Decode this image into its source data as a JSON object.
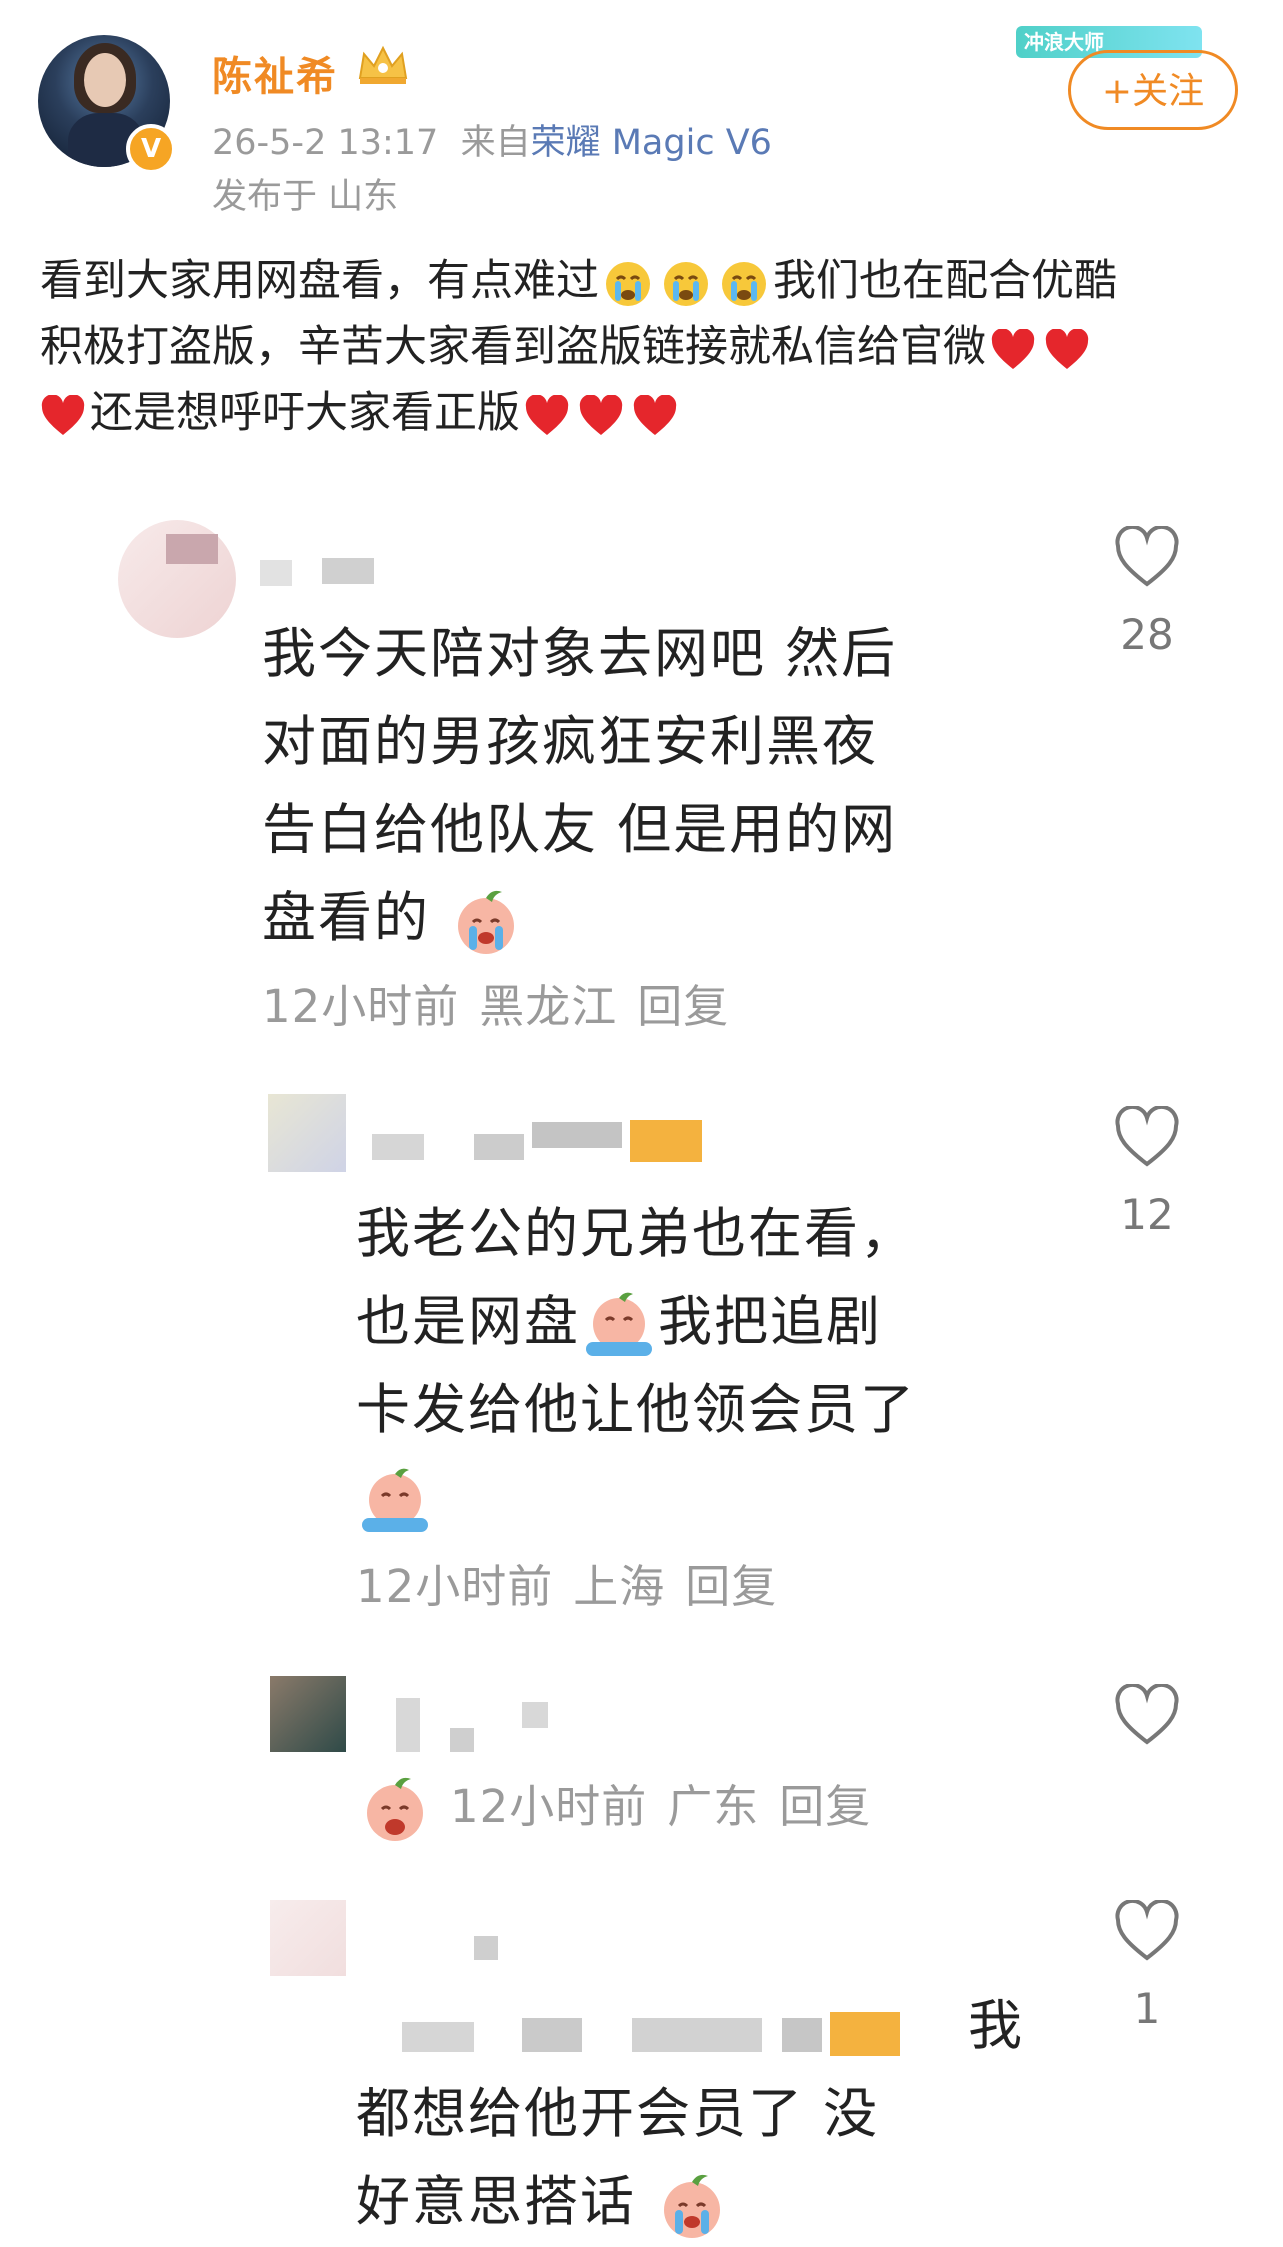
{
  "post": {
    "username": "陈祉希",
    "time": "26-5-2 13:17",
    "source_prefix": "来自",
    "source_device": "荣耀 Magic V6",
    "location": "发布于 山东",
    "follow_label": "+关注",
    "sticker_label": "冲浪大师",
    "text_line1a": "看到大家用网盘看，有点难过",
    "text_line1b": "我们也在配合优酷",
    "text_line2": "积极打盗版，辛苦大家看到盗版链接就私信给官微",
    "text_line3": "还是想呼吁大家看正版"
  },
  "comments": [
    {
      "lines": [
        "我今天陪对象去网吧 然后",
        "对面的男孩疯狂安利黑夜",
        "告白给他队友 但是用的网",
        "盘看的"
      ],
      "time": "12小时前",
      "location": "黑龙江",
      "reply": "回复",
      "likes": "28"
    },
    {
      "lines": [
        "我老公的兄弟也在看，",
        "也是网盘",
        "我把追剧",
        "卡发给他让他领会员了"
      ],
      "time": "12小时前",
      "location": "上海",
      "reply": "回复",
      "likes": "12"
    },
    {
      "time": "12小时前",
      "location": "广东",
      "reply": "回复",
      "likes": ""
    },
    {
      "lines": [
        "我",
        "都想给他开会员了 没",
        "好意思搭话"
      ],
      "likes": "1"
    }
  ],
  "colors": {
    "accent": "#f08a24",
    "brand_link": "#5a7ab5",
    "meta": "#9a9a9a",
    "heart": "#e5262c"
  }
}
